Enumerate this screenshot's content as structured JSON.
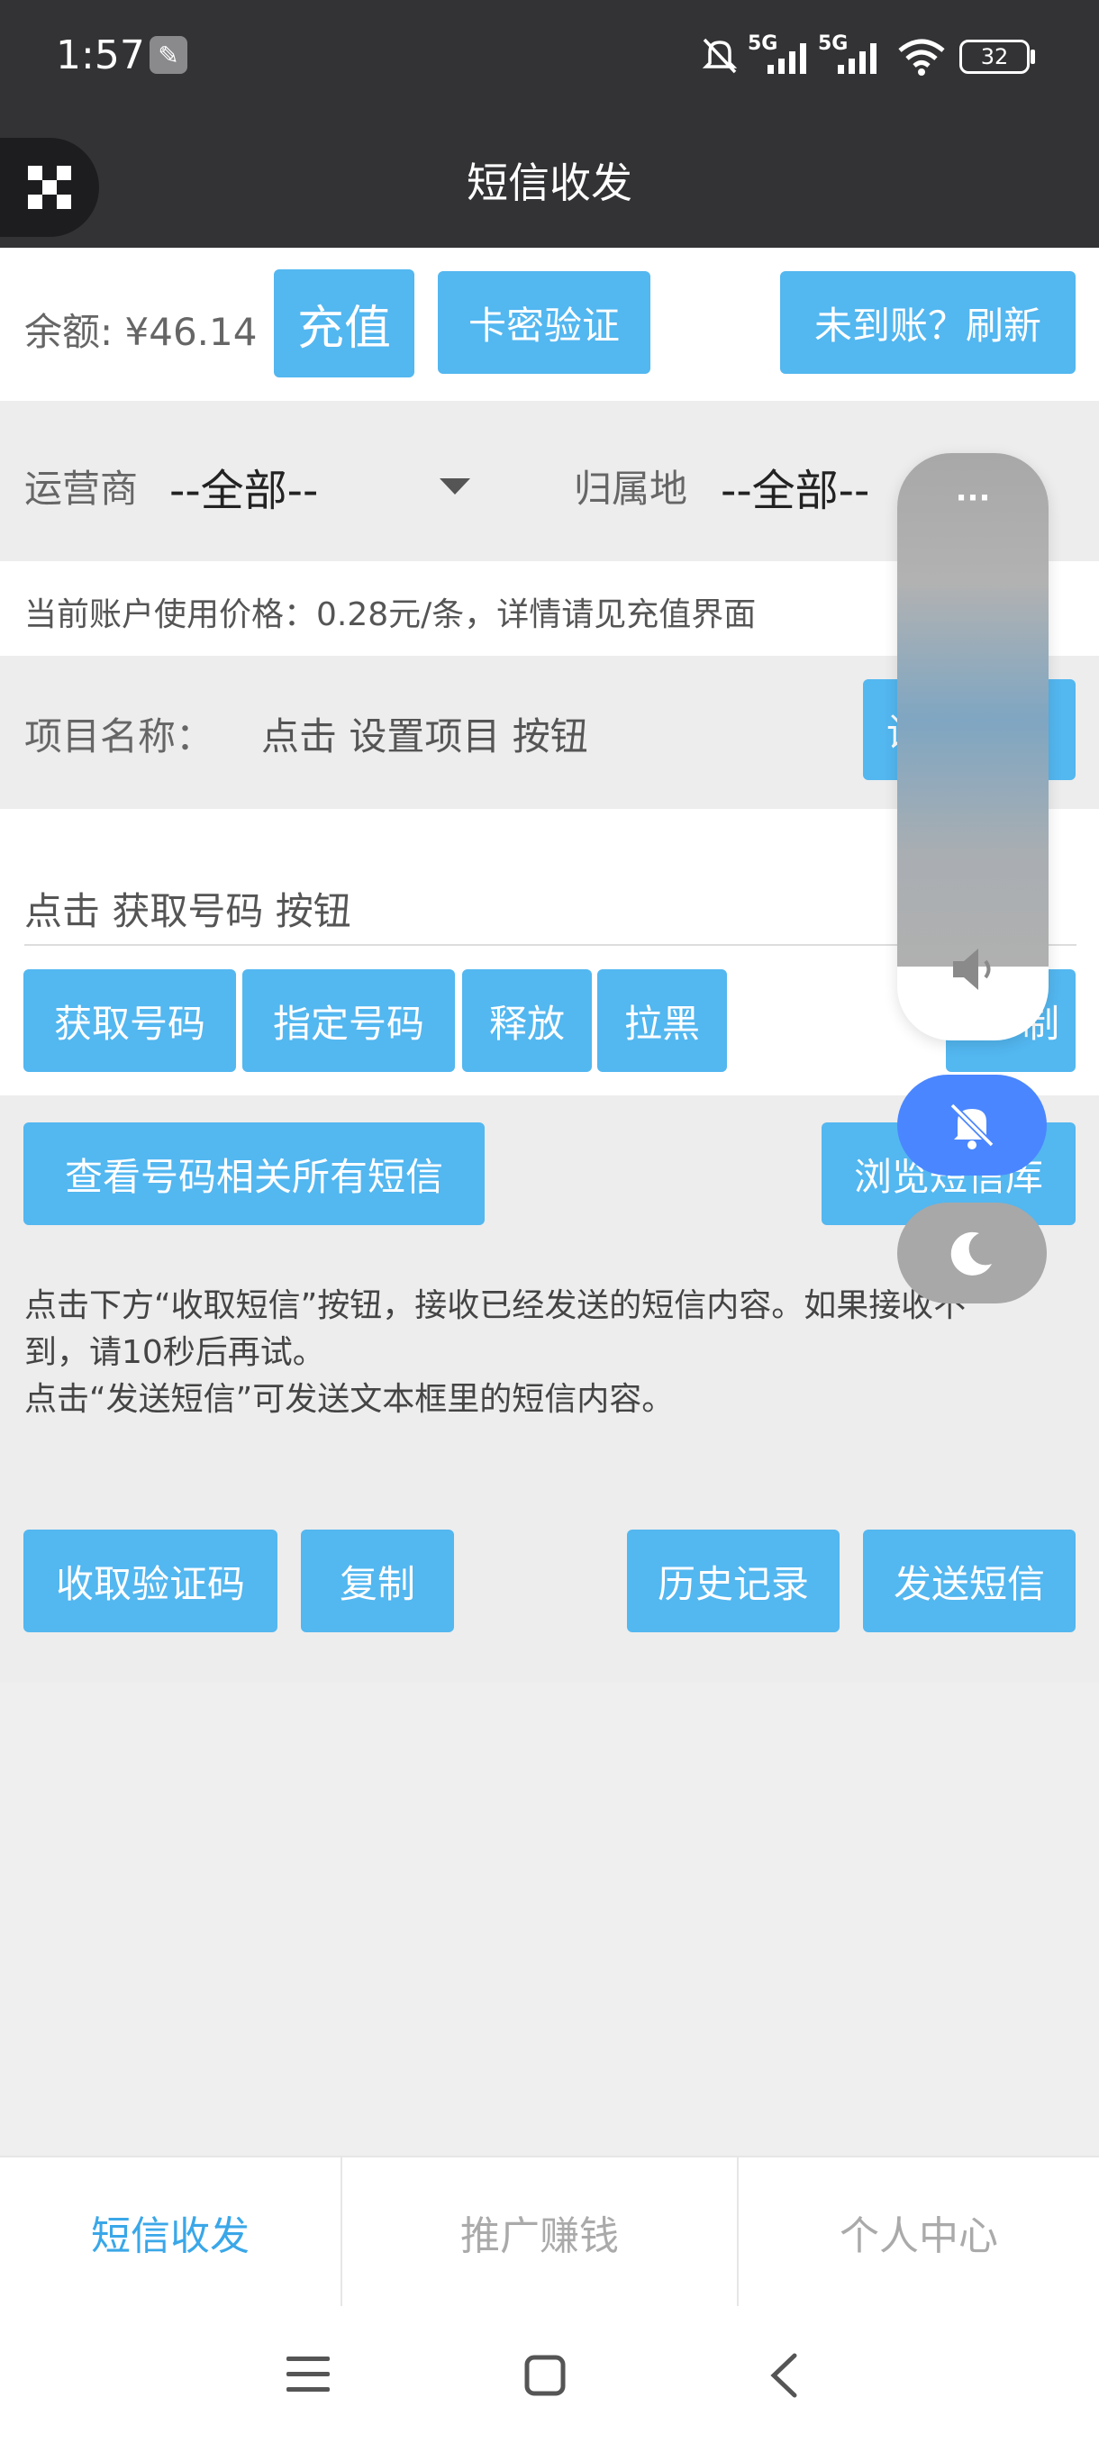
{
  "status": {
    "time": "1:57",
    "net1": "5G",
    "net2": "5G",
    "battery": "32"
  },
  "header": {
    "title": "短信收发"
  },
  "balance": {
    "label": "余额: ¥46.14",
    "recharge": "充值",
    "card_verify": "卡密验证",
    "refresh": "未到账？刷新"
  },
  "filters": {
    "carrier_label": "运营商",
    "carrier_value": "--全部--",
    "location_label": "归属地",
    "location_value": "--全部--"
  },
  "price_note": "当前账户使用价格：0.28元/条，详情请见充值界面",
  "project": {
    "label": "项目名称：",
    "value": "点击 设置项目 按钮",
    "button": "设"
  },
  "number": {
    "placeholder": "点击 获取号码 按钮",
    "get": "获取号码",
    "specify": "指定号码",
    "release": "释放",
    "blacklist": "拉黑",
    "copy_partial": "制"
  },
  "sms": {
    "view_all": "查看号码相关所有短信",
    "browse": "浏览短信库"
  },
  "instructions": {
    "line1": "点击下方“收取短信”按钮，接收已经发送的短信内容。如果接收不",
    "line2": "到，请10秒后再试。",
    "line3": "点击“发送短信”可发送文本框里的短信内容。"
  },
  "actions": {
    "receive": "收取验证码",
    "copy": "复制",
    "history": "历史记录",
    "send": "发送短信"
  },
  "tabs": [
    {
      "label": "短信收发",
      "active": true
    },
    {
      "label": "推广赚钱",
      "active": false
    },
    {
      "label": "个人中心",
      "active": false
    }
  ],
  "overlay": {
    "more": "···"
  },
  "colors": {
    "accent": "#53b7f0",
    "dark": "#333335",
    "active_tab": "#3aa7e8",
    "bell": "#4a86ff"
  }
}
